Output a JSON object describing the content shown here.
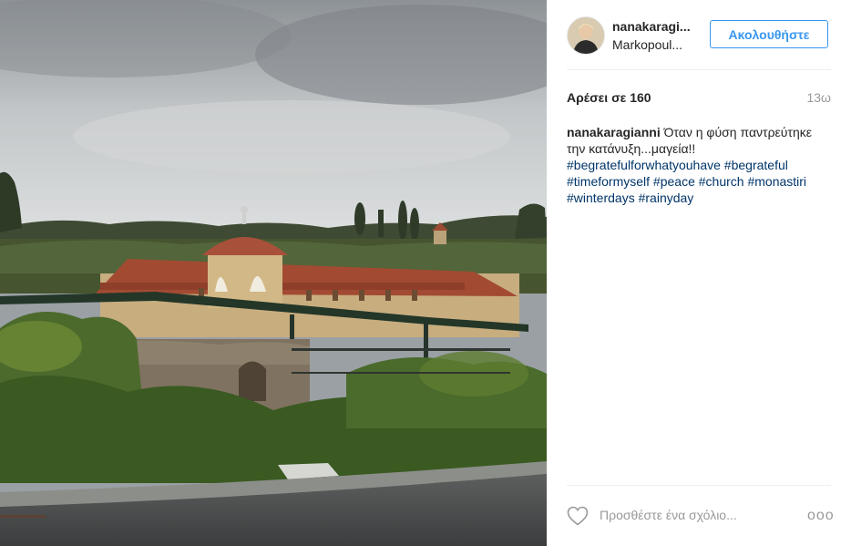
{
  "photo": {
    "alt": "",
    "subject-icon": "church-photo"
  },
  "header": {
    "username": "nanakaragi...",
    "location": "Markopoul...",
    "follow_label": "Ακολουθήστε",
    "avatar_icon": "avatar-photo"
  },
  "stats": {
    "likes": "Αρέσει σε 160",
    "time": "13ω"
  },
  "caption": {
    "user": "nanakaragianni",
    "text": "Όταν η φύση παντρεύτηκε την κατάνυξη...μαγεία!!",
    "hashtags": [
      "#begratefulforwhatyouhave",
      "#begrateful",
      "#timeformyself",
      "#peace",
      "#church",
      "#monastiri",
      "#winterdays",
      "#rainyday"
    ]
  },
  "comment": {
    "placeholder": "Προσθέστε ένα σχόλιο...",
    "more_label": "ooo"
  },
  "colors": {
    "accent": "#3897f0",
    "hashtag": "#003569",
    "muted": "#999999",
    "divider": "#efefef"
  }
}
